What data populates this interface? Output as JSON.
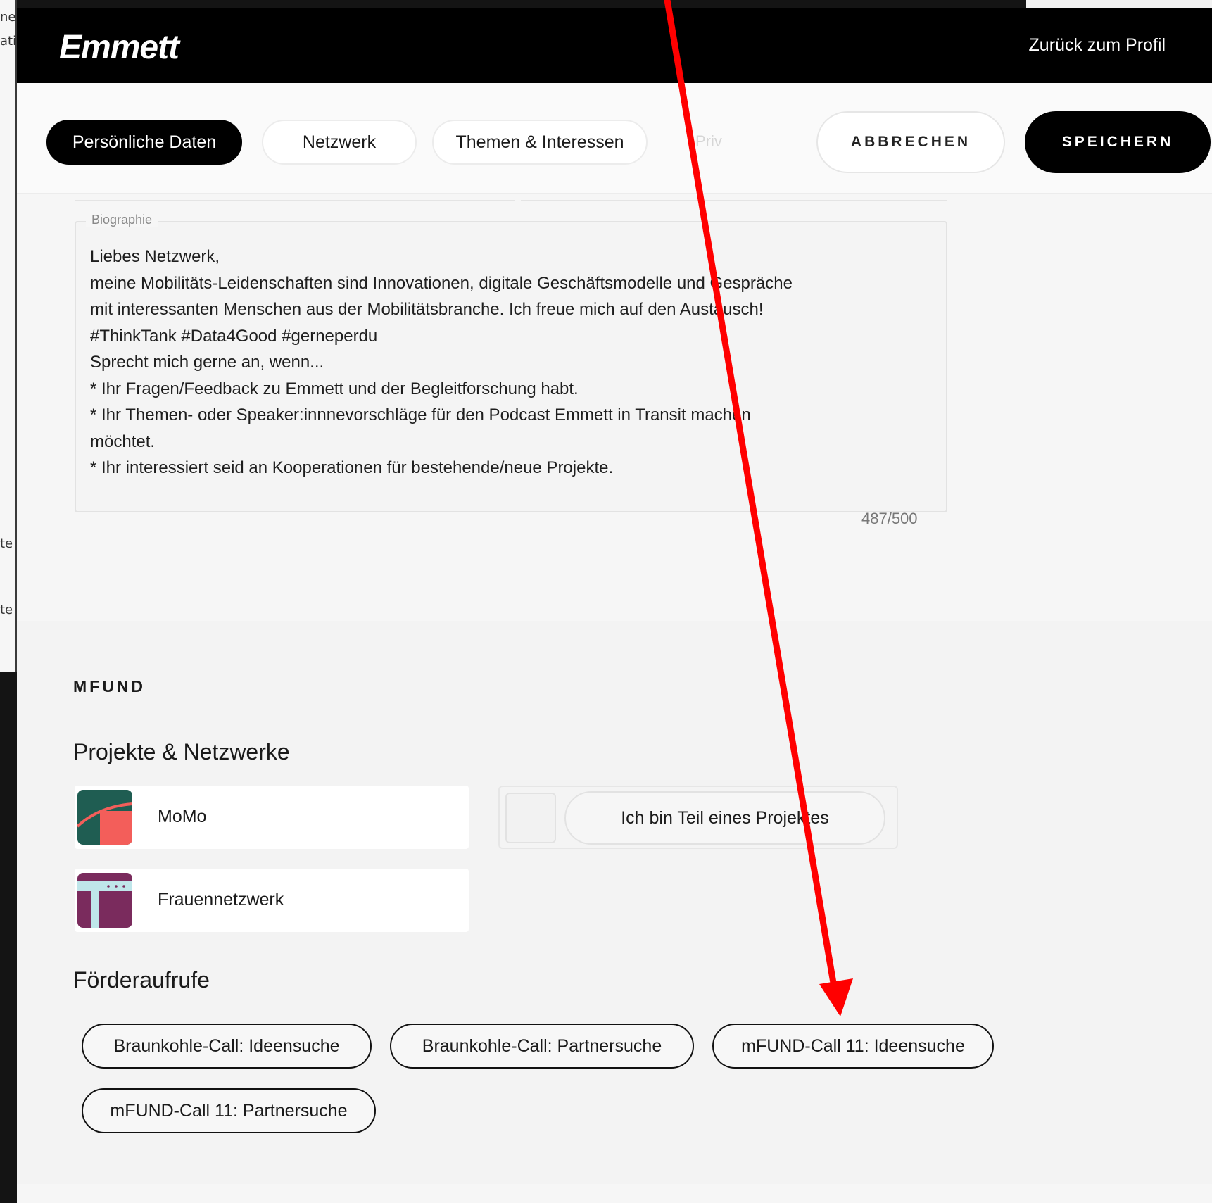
{
  "background": {
    "left_fragments": [
      "ne",
      "ati",
      "te",
      "te"
    ]
  },
  "header": {
    "logo": "Emmett",
    "back_link": "Zurück zum Profil"
  },
  "tabs": [
    {
      "label": "Persönliche Daten",
      "active": true
    },
    {
      "label": "Netzwerk",
      "active": false
    },
    {
      "label": "Themen & Interessen",
      "active": false
    },
    {
      "label": "Priv",
      "active": false
    }
  ],
  "actions": {
    "cancel_label": "ABBRECHEN",
    "save_label": "SPEICHERN"
  },
  "bio": {
    "label": "Biographie",
    "lines": [
      "Liebes Netzwerk,",
      "meine Mobilitäts-Leidenschaften sind Innovationen, digitale Geschäftsmodelle und Gespräche",
      "mit interessanten Menschen aus der Mobilitätsbranche. Ich freue mich auf den Austausch!",
      "#ThinkTank #Data4Good #gerneperdu",
      "Sprecht mich gerne an, wenn...",
      "* Ihr Fragen/Feedback zu Emmett und der Begleitforschung habt.",
      "* Ihr Themen- oder Speaker:innnevorschläge für den Podcast Emmett in Transit machen",
      "möchtet.",
      "* Ihr interessiert seid an Kooperationen für bestehende/neue Projekte."
    ],
    "counter": "487/500"
  },
  "mfund": {
    "kicker": "MFUND",
    "projects_heading": "Projekte & Netzwerke",
    "projects": [
      {
        "name": "MoMo",
        "icon": "momo-logo"
      },
      {
        "name": "Frauennetzwerk",
        "icon": "frauennetzwerk-logo"
      }
    ],
    "join_label": "Ich bin Teil eines Projektes",
    "calls_heading": "Förderaufrufe",
    "calls": [
      "Braunkohle-Call: Ideensuche",
      "Braunkohle-Call: Partnersuche",
      "mFUND-Call 11: Ideensuche",
      "mFUND-Call 11: Partnersuche"
    ]
  },
  "colors": {
    "annotation_arrow": "#ff0000",
    "momo_green": "#1f5d52",
    "momo_coral": "#f35e5a",
    "frauen_purple": "#7a2b5d",
    "frauen_light": "#bfe6ea"
  }
}
